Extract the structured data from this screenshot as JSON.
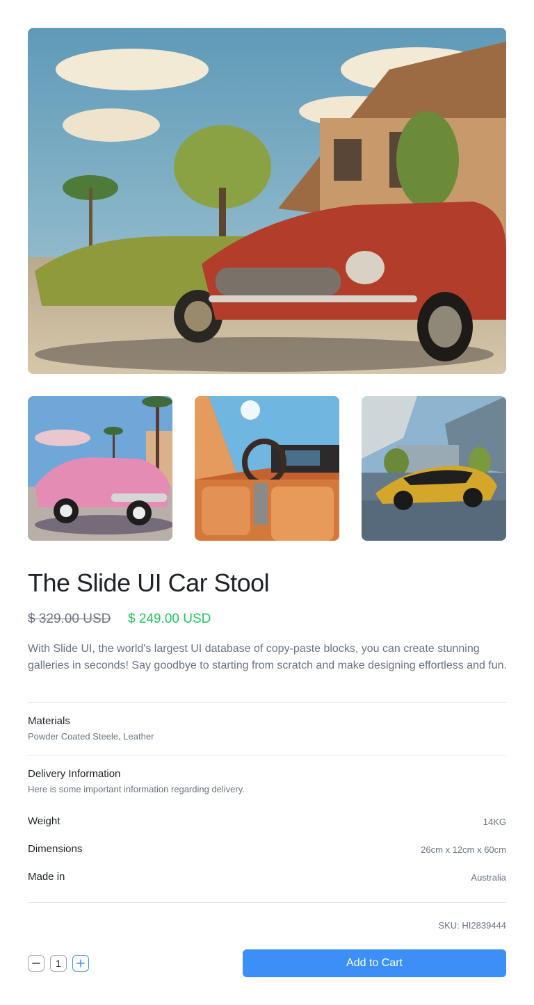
{
  "product": {
    "title": "The Slide UI Car Stool",
    "price_old": "$ 329.00 USD",
    "price_new": "$ 249.00 USD",
    "description": "With Slide UI, the world's largest UI database of copy-paste blocks, you can create stunning galleries in seconds! Say goodbye to starting from scratch and make designing effortless and fun.",
    "sku": "SKU: HI2839444"
  },
  "gallery": {
    "hero": "image-red-and-green-vintage-cars",
    "thumbnails": [
      "image-pink-vintage-car",
      "image-orange-car-interior",
      "image-gold-supercar"
    ]
  },
  "materials": {
    "title": "Materials",
    "value": "Powder Coated Steele, Leather"
  },
  "delivery": {
    "title": "Delivery Information",
    "subtitle": "Here is some important information regarding delivery."
  },
  "specs": [
    {
      "label": "Weight",
      "value": "14KG"
    },
    {
      "label": "Dimensions",
      "value": "26cm x 12cm x 60cm"
    },
    {
      "label": "Made in",
      "value": "Australia"
    }
  ],
  "cart": {
    "quantity": "1",
    "add_label": "Add to Cart"
  },
  "colors": {
    "accent": "#3b8ff6",
    "sale": "#22c55e",
    "muted": "#6b7280"
  },
  "icons": {
    "decrement": "minus-icon",
    "increment": "plus-icon"
  }
}
